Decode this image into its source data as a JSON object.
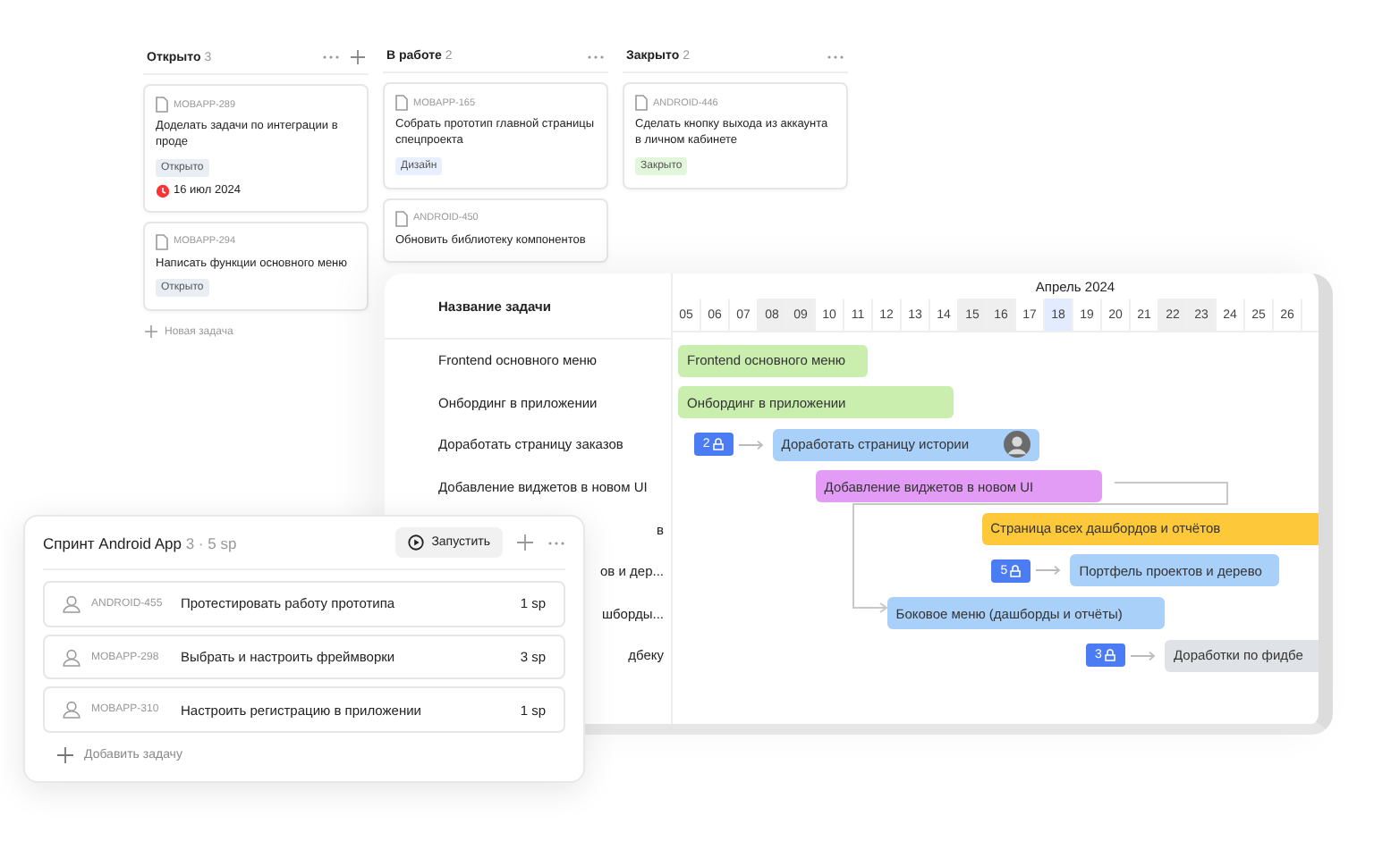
{
  "board": {
    "columns": [
      {
        "title": "Открыто",
        "count": "3",
        "add": true,
        "cards": [
          {
            "key": "MOBAPP-289",
            "title": "Доделать задачи по интеграции в проде",
            "tag": {
              "text": "Открыто",
              "color": "#e9eef5"
            },
            "deadline": "16 июл 2024"
          },
          {
            "key": "MOBAPP-294",
            "title": "Написать функции основного меню",
            "tag": {
              "text": "Открыто",
              "color": "#e9eef5"
            }
          }
        ],
        "new_task": "Новая задача"
      },
      {
        "title": "В работе",
        "count": "2",
        "add": false,
        "cards": [
          {
            "key": "MOBAPP-165",
            "title": "Собрать прототип главной страницы спецпроекта",
            "tag": {
              "text": "Дизайн",
              "color": "#e8f0ff"
            }
          },
          {
            "key": "ANDROID-450",
            "title": "Обновить библиотеку компонентов"
          }
        ]
      },
      {
        "title": "Закрыто",
        "count": "2",
        "add": false,
        "cards": [
          {
            "key": "ANDROID-446",
            "title": "Сделать кнопку выхода из аккаунта в личном кабинете",
            "tag": {
              "text": "Закрыто",
              "color": "#e2f6dc"
            }
          }
        ]
      }
    ]
  },
  "gantt": {
    "list_header": "Название задачи",
    "month": "Апрель 2024",
    "dates": [
      {
        "d": "05",
        "weekend": false,
        "today": false
      },
      {
        "d": "06",
        "weekend": false,
        "today": false
      },
      {
        "d": "07",
        "weekend": false,
        "today": false
      },
      {
        "d": "08",
        "weekend": true,
        "today": false
      },
      {
        "d": "09",
        "weekend": true,
        "today": false
      },
      {
        "d": "10",
        "weekend": false,
        "today": false
      },
      {
        "d": "11",
        "weekend": false,
        "today": false
      },
      {
        "d": "12",
        "weekend": false,
        "today": false
      },
      {
        "d": "13",
        "weekend": false,
        "today": false
      },
      {
        "d": "14",
        "weekend": false,
        "today": false
      },
      {
        "d": "15",
        "weekend": true,
        "today": false
      },
      {
        "d": "16",
        "weekend": true,
        "today": false
      },
      {
        "d": "17",
        "weekend": false,
        "today": false
      },
      {
        "d": "18",
        "weekend": false,
        "today": true
      },
      {
        "d": "19",
        "weekend": false,
        "today": false
      },
      {
        "d": "20",
        "weekend": false,
        "today": false
      },
      {
        "d": "21",
        "weekend": false,
        "today": false
      },
      {
        "d": "22",
        "weekend": true,
        "today": false
      },
      {
        "d": "23",
        "weekend": true,
        "today": false
      },
      {
        "d": "24",
        "weekend": false,
        "today": false
      },
      {
        "d": "25",
        "weekend": false,
        "today": false
      },
      {
        "d": "26",
        "weekend": false,
        "today": false
      }
    ],
    "tasks": [
      {
        "name": "Frontend основного меню",
        "partial": false,
        "bar": "Frontend основного меню",
        "color": "#c9eeae"
      },
      {
        "name": "Онбординг в приложении",
        "partial": false,
        "bar": "Онбординг в приложении",
        "color": "#c9eeae"
      },
      {
        "name": "Доработать страницу заказов",
        "partial": false,
        "bar": "Доработать страницу истории",
        "color": "#a8d0f8",
        "badge": "2",
        "avatar": true
      },
      {
        "name": "Добавление виджетов в новом UI",
        "partial": false,
        "bar": "Добавление виджетов в новом UI",
        "color": "#e29cf5"
      },
      {
        "name": "в",
        "partial": true,
        "bar": "Страница всех дашбордов и отчётов",
        "color": "#fdc93a"
      },
      {
        "name": "ов и дер...",
        "partial": true,
        "bar": "Портфель проектов и дерево",
        "color": "#a8d0f8",
        "badge": "5"
      },
      {
        "name": "шборды...",
        "partial": true,
        "bar": "Боковое меню (дашборды и отчёты)",
        "color": "#a8d0f8"
      },
      {
        "name": "дбеку",
        "partial": true,
        "bar": "Доработки по фидбе",
        "color": "#dfe3e8",
        "badge": "3"
      }
    ]
  },
  "sprint": {
    "title": "Спринт Android App",
    "meta": "3 · 5 sp",
    "start_button": "Запустить",
    "items": [
      {
        "key": "ANDROID-455",
        "title": "Протестировать работу прототипа",
        "points": "1 sp"
      },
      {
        "key": "MOBAPP-298",
        "title": "Выбрать и настроить фреймворки",
        "points": "3 sp"
      },
      {
        "key": "MOBAPP-310",
        "title": "Настроить регистрацию в приложении",
        "points": "1 sp"
      }
    ],
    "add_task": "Добавить задачу"
  }
}
